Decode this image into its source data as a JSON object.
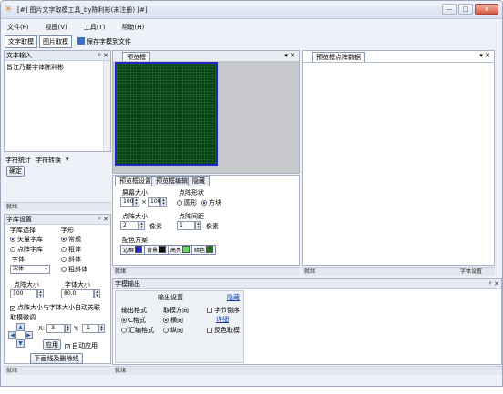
{
  "window": {
    "title": "[#] 图片文字取模工具_by陈利彬(未注册) [#]",
    "controls": [
      "—",
      "□",
      "x"
    ]
  },
  "menu": [
    "文件(F)",
    "视图(V)",
    "工具(T)",
    "帮助(H)"
  ],
  "toolbar": {
    "text_tab": "文字取模",
    "image_tab": "图片取模",
    "save": "保存字模到文件"
  },
  "text_input": {
    "title": "文本输入",
    "pin": "ᵖ",
    "close": "✕",
    "content": "皆江乃要字体陈利彬"
  },
  "char_stats": {
    "tab1": "字符统计",
    "tab2": "字符转换",
    "dropdown": "▾",
    "confirm": "确定"
  },
  "status": {
    "ready": "就绪"
  },
  "font_settings": {
    "title": "字库设置",
    "lib_label": "字库选择",
    "vector": "矢量字库",
    "bitmap": "点阵字库",
    "font_label": "字体",
    "font_value": "宋体",
    "style_label": "字形",
    "regular": "常规",
    "bold": "粗体",
    "italic": "斜体",
    "bold_italic": "粗斜体",
    "dot_size_label": "点阵大小",
    "dot_size_value": "100",
    "font_size_label": "字体大小",
    "font_size_value": "80.0",
    "auto_link": "点阵大小与字体大小自动关联",
    "fine_tune": "取模微调",
    "x_label": "X:",
    "x_value": "-3",
    "y_label": "Y:",
    "y_value": "-1",
    "apply": "应用",
    "auto_apply": "自动应用",
    "grid_lines": "下画线及删除线"
  },
  "preview": {
    "tab": "预览框",
    "pin": "▾",
    "close": "✕"
  },
  "preview_settings": {
    "tabs": [
      "预览框设置",
      "预览框编辑",
      "隐藏"
    ],
    "screen_size_label": "屏幕大小",
    "w": "100",
    "h": "100",
    "x": "×",
    "dot_shape_label": "点阵形状",
    "circle": "圆形",
    "square": "方块",
    "dot_size_label": "点阵大小",
    "dot_size_value": "2",
    "pixel": "像素",
    "dot_gap_label": "点阵间距",
    "dot_gap_value": "1",
    "pixel2": "像素",
    "color_label": "配色方案",
    "colors": [
      {
        "label": "边框",
        "hex": "#1f27c9"
      },
      {
        "label": "背景",
        "hex": "#111111"
      },
      {
        "label": "高亮",
        "hex": "#5fdc5f"
      },
      {
        "label": "暗色",
        "hex": "#1d7a1d"
      }
    ]
  },
  "data_panel": {
    "tab": "预览框点阵数据",
    "pin": "▾",
    "close": "✕",
    "font_settings": "字体设置"
  },
  "output": {
    "title": "字模输出",
    "settings": "输出设置",
    "hide": "隐藏",
    "format_label": "输出格式",
    "c_format": "C格式",
    "asm_format": "汇编格式",
    "direction_label": "取模方向",
    "horizontal": "横向",
    "vertical": "纵向",
    "byte_reverse": "字节倒序",
    "detail": "详细",
    "invert": "反色取模"
  }
}
